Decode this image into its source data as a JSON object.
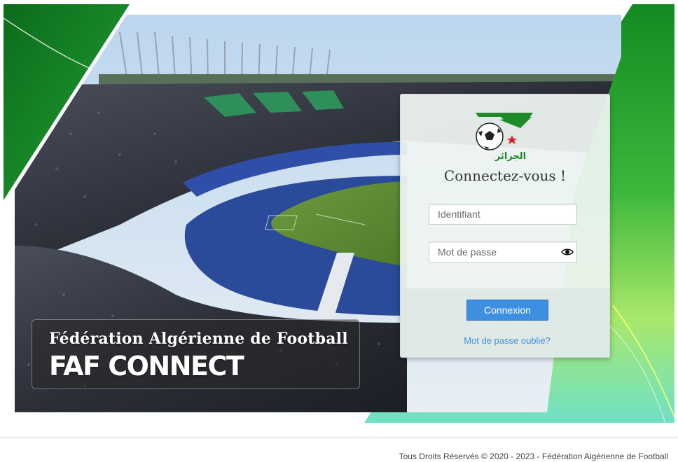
{
  "banner": {
    "title": "Fédération Algérienne de Football",
    "brand": "FAF CONNECT"
  },
  "login": {
    "heading": "Connectez-vous !",
    "username_placeholder": "Identifiant",
    "password_placeholder": "Mot de passe",
    "submit_label": "Connexion",
    "forgot_label": "Mot de passe oublié?",
    "logo_text": "الجزائر"
  },
  "footer": {
    "copyright": "Tous Droits Réservés © 2020 - 2023 - Fédération Algérienne de Football"
  },
  "colors": {
    "brand_green": "#1e8a2a",
    "button_blue": "#3f8fe0",
    "logo_red": "#d61f26"
  },
  "icons": {
    "password_toggle": "eye-icon"
  }
}
